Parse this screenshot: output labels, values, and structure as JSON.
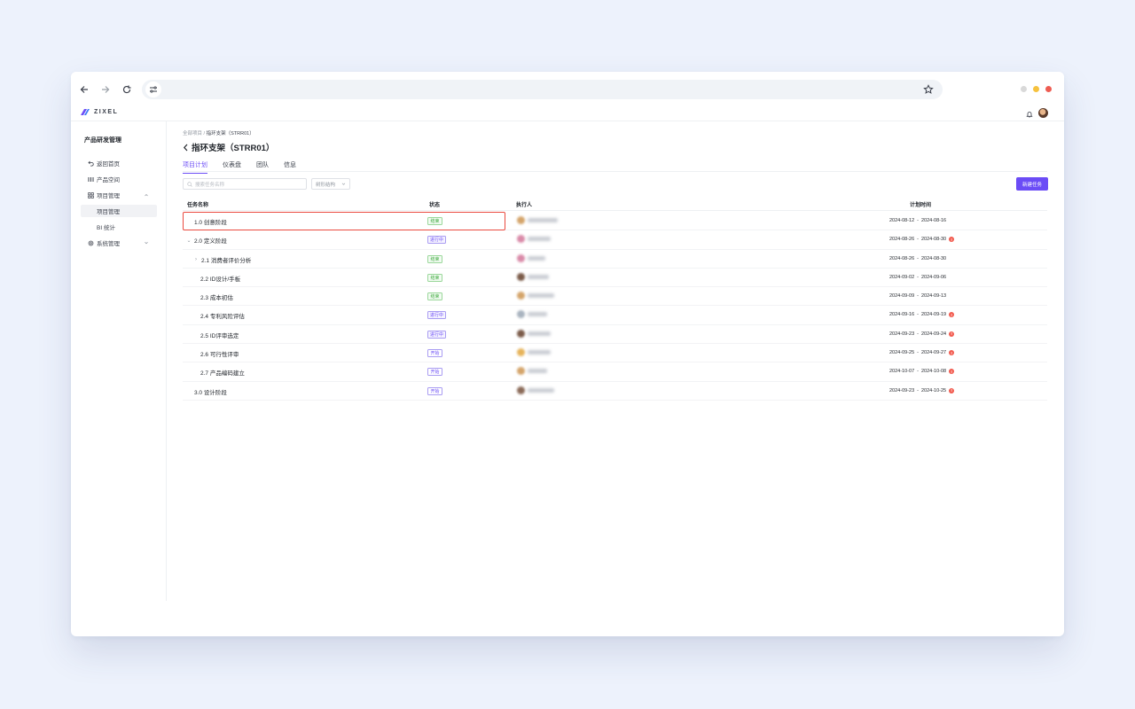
{
  "browser": {
    "back_icon": "arrow-left-icon",
    "forward_icon": "arrow-right-icon",
    "reload_icon": "reload-icon",
    "site_info_icon": "tune-icon",
    "bookmark_icon": "star-icon",
    "window_dots": [
      "#d9d9d9",
      "#f6c23e",
      "#ee5c52"
    ]
  },
  "app": {
    "logo_text": "ZIXEL",
    "bell_icon": "bell-icon"
  },
  "sidebar": {
    "title": "产品研发管理",
    "items": [
      {
        "label": "返回首页",
        "icon": "back-icon"
      },
      {
        "label": "产品空间",
        "icon": "columns-icon"
      },
      {
        "label": "项目管理",
        "icon": "grid-icon"
      },
      {
        "label": "项目管理"
      },
      {
        "label": "BI 统计"
      },
      {
        "label": "系统管理",
        "icon": "gear-icon"
      }
    ]
  },
  "main": {
    "breadcrumb_root": "全部项目",
    "breadcrumb_sep": "/",
    "breadcrumb_current": "指环支架（STRR01）",
    "title": "指环支架（STRR01）",
    "tabs": [
      "项目计划",
      "仪表盘",
      "团队",
      "信息"
    ],
    "search_placeholder": "搜索任务名称",
    "tree_select": "树形结构",
    "new_task_button": "新建任务"
  },
  "table": {
    "headers": {
      "name": "任务名称",
      "status": "状态",
      "assignee": "执行人",
      "schedule": "计划时间"
    },
    "date_sep": "-",
    "rows": [
      {
        "name": "1.0 创意阶段",
        "indent": 0,
        "toggle": "",
        "status": "结束",
        "status_type": "done",
        "start": "2024-08-12",
        "end": "2024-08-16",
        "warn": false,
        "avatar_color": "#d4a46a",
        "highlight": true
      },
      {
        "name": "2.0 定义阶段",
        "indent": 0,
        "toggle": "⌄",
        "status": "进行中",
        "status_type": "prog",
        "start": "2024-08-26",
        "end": "2024-08-30",
        "warn": true,
        "avatar_color": "#d98aa8"
      },
      {
        "name": "2.1 消费者评价分析",
        "indent": 1,
        "toggle": "›",
        "status": "结束",
        "status_type": "done",
        "start": "2024-08-26",
        "end": "2024-08-30",
        "warn": false,
        "avatar_color": "#d98aa8"
      },
      {
        "name": "2.2 ID设计/手板",
        "indent": 2,
        "toggle": "",
        "status": "结束",
        "status_type": "done",
        "start": "2024-09-02",
        "end": "2024-09-06",
        "warn": false,
        "avatar_color": "#7a5a48"
      },
      {
        "name": "2.3 成本初估",
        "indent": 2,
        "toggle": "",
        "status": "结束",
        "status_type": "done",
        "start": "2024-09-09",
        "end": "2024-09-13",
        "warn": false,
        "avatar_color": "#d4a46a"
      },
      {
        "name": "2.4 专利风险评估",
        "indent": 2,
        "toggle": "",
        "status": "进行中",
        "status_type": "prog",
        "start": "2024-09-16",
        "end": "2024-09-19",
        "warn": true,
        "avatar_color": "#a9b3bf"
      },
      {
        "name": "2.5 ID评审选定",
        "indent": 2,
        "toggle": "",
        "status": "进行中",
        "status_type": "prog",
        "start": "2024-09-23",
        "end": "2024-09-24",
        "warn": true,
        "avatar_color": "#7a5a48"
      },
      {
        "name": "2.6 可行性评审",
        "indent": 2,
        "toggle": "",
        "status": "开始",
        "status_type": "start",
        "start": "2024-09-25",
        "end": "2024-09-27",
        "warn": true,
        "avatar_color": "#e6b35a"
      },
      {
        "name": "2.7 产品编码建立",
        "indent": 2,
        "toggle": "",
        "status": "开始",
        "status_type": "start",
        "start": "2024-10-07",
        "end": "2024-10-08",
        "warn": true,
        "avatar_color": "#d4a46a"
      },
      {
        "name": "3.0 设计阶段",
        "indent": 0,
        "toggle": "",
        "status": "开始",
        "status_type": "start",
        "start": "2024-09-23",
        "end": "2024-10-25",
        "warn": true,
        "avatar_color": "#8a6a58"
      }
    ]
  }
}
